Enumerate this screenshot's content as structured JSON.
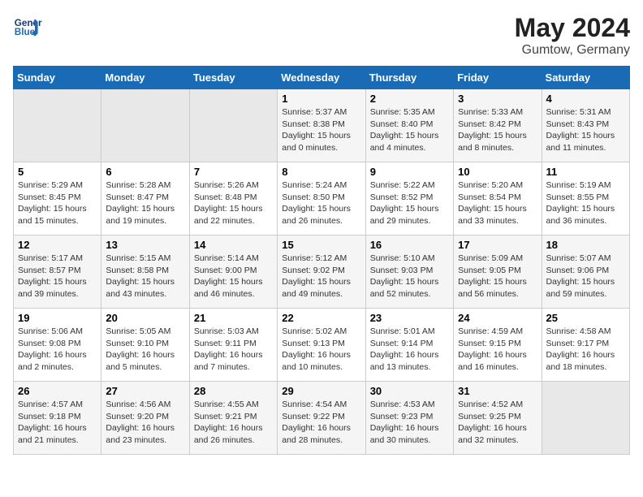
{
  "header": {
    "logo_line1": "General",
    "logo_line2": "Blue",
    "title": "May 2024",
    "subtitle": "Gumtow, Germany"
  },
  "calendar": {
    "weekdays": [
      "Sunday",
      "Monday",
      "Tuesday",
      "Wednesday",
      "Thursday",
      "Friday",
      "Saturday"
    ],
    "weeks": [
      [
        {
          "day": "",
          "info": ""
        },
        {
          "day": "",
          "info": ""
        },
        {
          "day": "",
          "info": ""
        },
        {
          "day": "1",
          "info": "Sunrise: 5:37 AM\nSunset: 8:38 PM\nDaylight: 15 hours\nand 0 minutes."
        },
        {
          "day": "2",
          "info": "Sunrise: 5:35 AM\nSunset: 8:40 PM\nDaylight: 15 hours\nand 4 minutes."
        },
        {
          "day": "3",
          "info": "Sunrise: 5:33 AM\nSunset: 8:42 PM\nDaylight: 15 hours\nand 8 minutes."
        },
        {
          "day": "4",
          "info": "Sunrise: 5:31 AM\nSunset: 8:43 PM\nDaylight: 15 hours\nand 11 minutes."
        }
      ],
      [
        {
          "day": "5",
          "info": "Sunrise: 5:29 AM\nSunset: 8:45 PM\nDaylight: 15 hours\nand 15 minutes."
        },
        {
          "day": "6",
          "info": "Sunrise: 5:28 AM\nSunset: 8:47 PM\nDaylight: 15 hours\nand 19 minutes."
        },
        {
          "day": "7",
          "info": "Sunrise: 5:26 AM\nSunset: 8:48 PM\nDaylight: 15 hours\nand 22 minutes."
        },
        {
          "day": "8",
          "info": "Sunrise: 5:24 AM\nSunset: 8:50 PM\nDaylight: 15 hours\nand 26 minutes."
        },
        {
          "day": "9",
          "info": "Sunrise: 5:22 AM\nSunset: 8:52 PM\nDaylight: 15 hours\nand 29 minutes."
        },
        {
          "day": "10",
          "info": "Sunrise: 5:20 AM\nSunset: 8:54 PM\nDaylight: 15 hours\nand 33 minutes."
        },
        {
          "day": "11",
          "info": "Sunrise: 5:19 AM\nSunset: 8:55 PM\nDaylight: 15 hours\nand 36 minutes."
        }
      ],
      [
        {
          "day": "12",
          "info": "Sunrise: 5:17 AM\nSunset: 8:57 PM\nDaylight: 15 hours\nand 39 minutes."
        },
        {
          "day": "13",
          "info": "Sunrise: 5:15 AM\nSunset: 8:58 PM\nDaylight: 15 hours\nand 43 minutes."
        },
        {
          "day": "14",
          "info": "Sunrise: 5:14 AM\nSunset: 9:00 PM\nDaylight: 15 hours\nand 46 minutes."
        },
        {
          "day": "15",
          "info": "Sunrise: 5:12 AM\nSunset: 9:02 PM\nDaylight: 15 hours\nand 49 minutes."
        },
        {
          "day": "16",
          "info": "Sunrise: 5:10 AM\nSunset: 9:03 PM\nDaylight: 15 hours\nand 52 minutes."
        },
        {
          "day": "17",
          "info": "Sunrise: 5:09 AM\nSunset: 9:05 PM\nDaylight: 15 hours\nand 56 minutes."
        },
        {
          "day": "18",
          "info": "Sunrise: 5:07 AM\nSunset: 9:06 PM\nDaylight: 15 hours\nand 59 minutes."
        }
      ],
      [
        {
          "day": "19",
          "info": "Sunrise: 5:06 AM\nSunset: 9:08 PM\nDaylight: 16 hours\nand 2 minutes."
        },
        {
          "day": "20",
          "info": "Sunrise: 5:05 AM\nSunset: 9:10 PM\nDaylight: 16 hours\nand 5 minutes."
        },
        {
          "day": "21",
          "info": "Sunrise: 5:03 AM\nSunset: 9:11 PM\nDaylight: 16 hours\nand 7 minutes."
        },
        {
          "day": "22",
          "info": "Sunrise: 5:02 AM\nSunset: 9:13 PM\nDaylight: 16 hours\nand 10 minutes."
        },
        {
          "day": "23",
          "info": "Sunrise: 5:01 AM\nSunset: 9:14 PM\nDaylight: 16 hours\nand 13 minutes."
        },
        {
          "day": "24",
          "info": "Sunrise: 4:59 AM\nSunset: 9:15 PM\nDaylight: 16 hours\nand 16 minutes."
        },
        {
          "day": "25",
          "info": "Sunrise: 4:58 AM\nSunset: 9:17 PM\nDaylight: 16 hours\nand 18 minutes."
        }
      ],
      [
        {
          "day": "26",
          "info": "Sunrise: 4:57 AM\nSunset: 9:18 PM\nDaylight: 16 hours\nand 21 minutes."
        },
        {
          "day": "27",
          "info": "Sunrise: 4:56 AM\nSunset: 9:20 PM\nDaylight: 16 hours\nand 23 minutes."
        },
        {
          "day": "28",
          "info": "Sunrise: 4:55 AM\nSunset: 9:21 PM\nDaylight: 16 hours\nand 26 minutes."
        },
        {
          "day": "29",
          "info": "Sunrise: 4:54 AM\nSunset: 9:22 PM\nDaylight: 16 hours\nand 28 minutes."
        },
        {
          "day": "30",
          "info": "Sunrise: 4:53 AM\nSunset: 9:23 PM\nDaylight: 16 hours\nand 30 minutes."
        },
        {
          "day": "31",
          "info": "Sunrise: 4:52 AM\nSunset: 9:25 PM\nDaylight: 16 hours\nand 32 minutes."
        },
        {
          "day": "",
          "info": ""
        }
      ]
    ]
  }
}
